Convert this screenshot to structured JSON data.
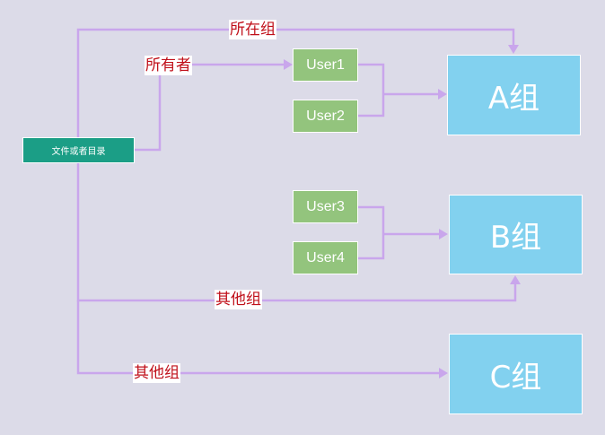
{
  "source": {
    "label": "文件或者目录"
  },
  "users": [
    {
      "label": "User1"
    },
    {
      "label": "User2"
    },
    {
      "label": "User3"
    },
    {
      "label": "User4"
    }
  ],
  "groups": [
    {
      "label": "A组"
    },
    {
      "label": "B组"
    },
    {
      "label": "C组"
    }
  ],
  "edge_labels": {
    "owner_group": "所在组",
    "owner": "所有者",
    "others_b": "其他组",
    "others_c": "其他组"
  },
  "colors": {
    "background": "#dcdbe8",
    "connector": "#c9a6ec",
    "source_fill": "#1b9e86",
    "user_fill": "#93c47d",
    "group_fill": "#82d1ef",
    "label_text": "#c0101a"
  }
}
